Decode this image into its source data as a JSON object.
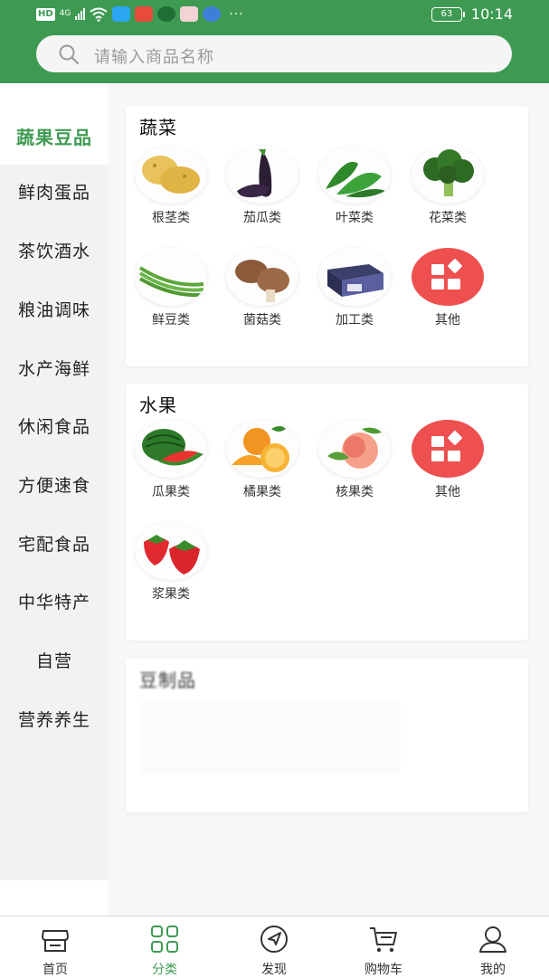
{
  "status_bar": {
    "hd_badge": "HD",
    "network": "4G",
    "battery": "63",
    "time": "10:14",
    "more": "···"
  },
  "search": {
    "placeholder": "请输入商品名称"
  },
  "categories": [
    {
      "label": "蔬果豆品",
      "active": true
    },
    {
      "label": "鲜肉蛋品"
    },
    {
      "label": "茶饮酒水"
    },
    {
      "label": "粮油调味"
    },
    {
      "label": "水产海鲜"
    },
    {
      "label": "休闲食品"
    },
    {
      "label": "方便速食"
    },
    {
      "label": "宅配食品"
    },
    {
      "label": "中华特产"
    },
    {
      "label": "自营"
    },
    {
      "label": "营养养生"
    }
  ],
  "sections": [
    {
      "title": "蔬菜",
      "items": [
        {
          "label": "根茎类",
          "icon": "potato-image"
        },
        {
          "label": "茄瓜类",
          "icon": "eggplant-image"
        },
        {
          "label": "叶菜类",
          "icon": "leafy-greens-image"
        },
        {
          "label": "花菜类",
          "icon": "broccoli-image"
        },
        {
          "label": "鲜豆类",
          "icon": "green-beans-image"
        },
        {
          "label": "菌菇类",
          "icon": "mushroom-image"
        },
        {
          "label": "加工类",
          "icon": "processed-food-image"
        },
        {
          "label": "其他",
          "icon": "grid-icon"
        }
      ]
    },
    {
      "title": "水果",
      "items": [
        {
          "label": "瓜果类",
          "icon": "watermelon-image"
        },
        {
          "label": "橘果类",
          "icon": "orange-image"
        },
        {
          "label": "核果类",
          "icon": "peach-image"
        },
        {
          "label": "其他",
          "icon": "grid-icon"
        },
        {
          "label": "浆果类",
          "icon": "strawberry-image"
        }
      ]
    },
    {
      "title": "豆制品",
      "items": []
    }
  ],
  "tabs": [
    {
      "label": "首页",
      "icon": "store-icon"
    },
    {
      "label": "分类",
      "icon": "category-grid-icon",
      "active": true
    },
    {
      "label": "发现",
      "icon": "compass-icon"
    },
    {
      "label": "购物车",
      "icon": "cart-icon"
    },
    {
      "label": "我的",
      "icon": "user-icon"
    }
  ],
  "colors": {
    "brand_green": "#3e9a52",
    "other_icon_red": "#ee5050",
    "inactive_text": "#333333"
  }
}
